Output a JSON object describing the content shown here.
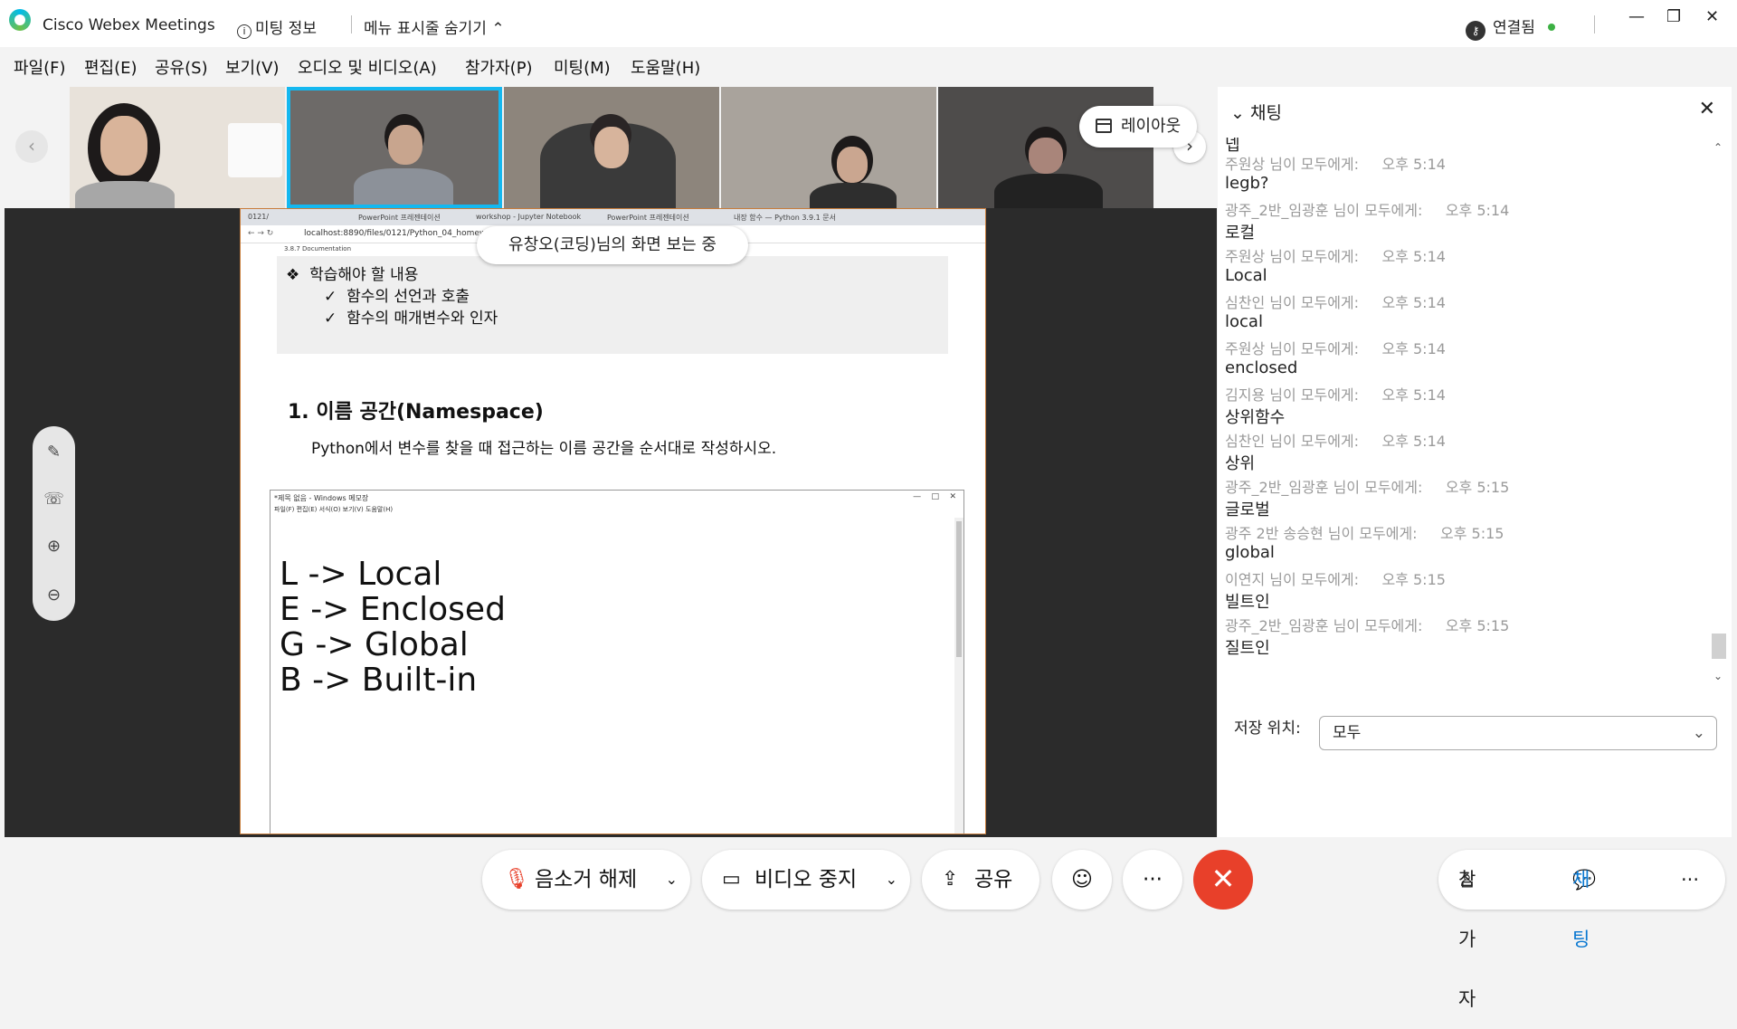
{
  "window": {
    "app_title": "Cisco Webex Meetings",
    "meeting_info": "미팅 정보",
    "hide_menu": "메뉴 표시줄 숨기기",
    "connection": "연결됨",
    "controls": {
      "minimize": "—",
      "restore": "❐",
      "close": "✕"
    }
  },
  "menu": [
    "파일(F)",
    "편집(E)",
    "공유(S)",
    "보기(V)",
    "오디오 및 비디오(A)",
    "참가자(P)",
    "미팅(M)",
    "도움말(H)"
  ],
  "filmstrip": {
    "layout_label": "레이아웃",
    "participants": [
      {
        "bg": "#e8e2da",
        "active": false
      },
      {
        "bg": "#6d6a68",
        "active": true
      },
      {
        "bg": "#8d857c",
        "active": false
      },
      {
        "bg": "#a9a39c",
        "active": false
      },
      {
        "bg": "#4e4c4b",
        "active": false
      }
    ]
  },
  "share": {
    "banner": "유창오(코딩)님의 화면 보는 중",
    "browser_tabs": [
      "0121/",
      "PowerPoint 프레젠테이션",
      "workshop - Jupyter Notebook",
      "PowerPoint 프레젠테이션",
      "내장 함수 — Python 3.9.1 문서"
    ],
    "url": "localhost:8890/files/0121/Python_04_homework.pdf",
    "bookmark": "3.8.7 Documentation",
    "pdf": {
      "box_title": "학습해야 할 내용",
      "box_items": [
        "함수의 선언과 호출",
        "함수의 매개변수와 인자"
      ],
      "heading": "1. 이름 공간(Namespace)",
      "paragraph": "Python에서 변수를 찾을 때 접근하는 이름 공간을 순서대로 작성하시오."
    },
    "notepad": {
      "title": "*제목 없음 - Windows 메모장",
      "menu": "파일(F)  편집(E)  서식(O)  보기(V)  도움말(H)",
      "lines": [
        "L -> Local",
        "E -> Enclosed",
        "G -> Global",
        "B -> Built-in"
      ]
    }
  },
  "chat": {
    "title": "채팅",
    "messages": [
      {
        "text": "넵"
      },
      {
        "from": "주원상 님이 모두에게:     오후 5:14",
        "text": "legb?"
      },
      {
        "from": "광주_2반_임광훈 님이 모두에게:     오후 5:14",
        "text": "로컬"
      },
      {
        "from": "주원상 님이 모두에게:     오후 5:14",
        "text": "Local"
      },
      {
        "from": "심찬인 님이 모두에게:     오후 5:14",
        "text": "local"
      },
      {
        "from": "주원상 님이 모두에게:     오후 5:14",
        "text": "enclosed"
      },
      {
        "from": "김지용 님이 모두에게:     오후 5:14",
        "text": "상위함수"
      },
      {
        "from": "심찬인 님이 모두에게:     오후 5:14",
        "text": "상위"
      },
      {
        "from": "광주_2반_임광훈 님이 모두에게:     오후 5:15",
        "text": "글로벌"
      },
      {
        "from": "광주 2반 송승현 님이 모두에게:     오후 5:15",
        "text": "global"
      },
      {
        "from": "이연지 님이 모두에게:     오후 5:15",
        "text": "빌트인"
      },
      {
        "from": "광주_2반_임광훈 님이 모두에게:     오후 5:15",
        "text": "질트인"
      }
    ],
    "save_label": "저장 위치:",
    "save_value": "모두"
  },
  "controls": {
    "mute": "음소거 해제",
    "video": "비디오 중지",
    "share": "공유",
    "participants": "참가자",
    "chat": "채팅",
    "accent": "#e8402a",
    "chat_accent": "#0a78d1"
  }
}
